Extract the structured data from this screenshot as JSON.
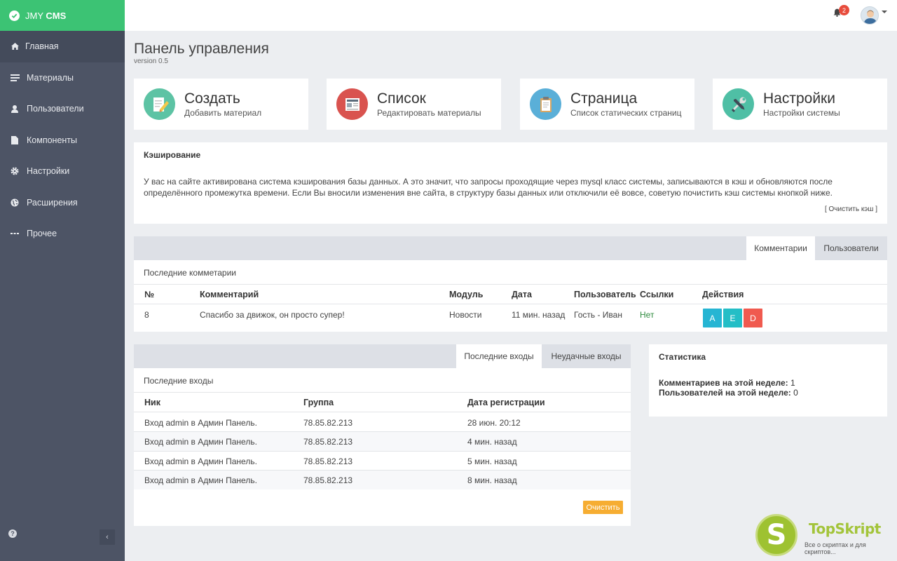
{
  "brand": {
    "light": "JMY",
    "bold": "CMS"
  },
  "sidebar": {
    "items": [
      {
        "label": "Главная",
        "icon": "home-icon"
      },
      {
        "label": "Материалы",
        "icon": "list-icon"
      },
      {
        "label": "Пользователи",
        "icon": "user-icon"
      },
      {
        "label": "Компоненты",
        "icon": "file-icon"
      },
      {
        "label": "Настройки",
        "icon": "gear-icon"
      },
      {
        "label": "Расширения",
        "icon": "globe-icon"
      },
      {
        "label": "Прочее",
        "icon": "dots-icon"
      }
    ],
    "help": "?",
    "collapse": "‹"
  },
  "topbar": {
    "notification_count": "2"
  },
  "page": {
    "title": "Панель управления",
    "version": "version 0.5"
  },
  "quick": [
    {
      "title": "Создать",
      "sub": "Добавить материал",
      "color": "#5dc3a4"
    },
    {
      "title": "Список",
      "sub": "Редактировать материалы",
      "color": "#d9534f"
    },
    {
      "title": "Страница",
      "sub": "Список статических страниц",
      "color": "#5aafd8"
    },
    {
      "title": "Настройки",
      "sub": "Настройки системы",
      "color": "#4fbfa5"
    }
  ],
  "cache": {
    "title": "Кэширование",
    "text": "У вас на сайте активирована система кэширования базы данных. А это значит, что запросы проходящие через mysql класс системы, записываются в кэш и обновляются после определённого промежутка времени. Если Вы вносили изменения вне сайта, в структуру базы данных или отключили её вовсе, советую почистить кэш системы кнопкой ниже.",
    "clear": "[ Очистить кэш ]"
  },
  "comments": {
    "tabs": [
      "Комментарии",
      "Пользователи"
    ],
    "label": "Последние комметарии",
    "columns": [
      "№",
      "Комментарий",
      "Модуль",
      "Дата",
      "Пользователь",
      "Ссылки",
      "Действия"
    ],
    "row": {
      "num": "8",
      "comment": "Спасибо за движок, он просто супер!",
      "module": "Новости",
      "date": "11 мин. назад",
      "user": "Гость - Иван",
      "links": "Нет"
    },
    "actions": [
      "A",
      "E",
      "D"
    ]
  },
  "logins": {
    "tabs": [
      "Последние входы",
      "Неудачные входы"
    ],
    "label": "Последние входы",
    "columns": [
      "Ник",
      "Группа",
      "Дата регистрации"
    ],
    "rows": [
      {
        "nick": "Вход admin в Админ Панель.",
        "group": "78.85.82.213",
        "date": "28 июн. 20:12"
      },
      {
        "nick": "Вход admin в Админ Панель.",
        "group": "78.85.82.213",
        "date": "4 мин. назад"
      },
      {
        "nick": "Вход admin в Админ Панель.",
        "group": "78.85.82.213",
        "date": "5 мин. назад"
      },
      {
        "nick": "Вход admin в Админ Панель.",
        "group": "78.85.82.213",
        "date": "8 мин. назад"
      }
    ],
    "clear": "Очистить"
  },
  "stats": {
    "title": "Статистика",
    "comments_label": "Комментариев на этой неделе:",
    "comments_value": "1",
    "users_label": "Пользователей на этой неделе:",
    "users_value": "0"
  },
  "watermark": {
    "letter": "S",
    "title": "TopSkript",
    "sub": "Все о скриптах и для скриптов..."
  },
  "colors": {
    "brand": "#3cc374",
    "sidebar": "#4d5465",
    "action_a": "#26b5d3",
    "action_e": "#24bec6",
    "action_d": "#f05a4f",
    "clear_button": "#f6ad32"
  }
}
